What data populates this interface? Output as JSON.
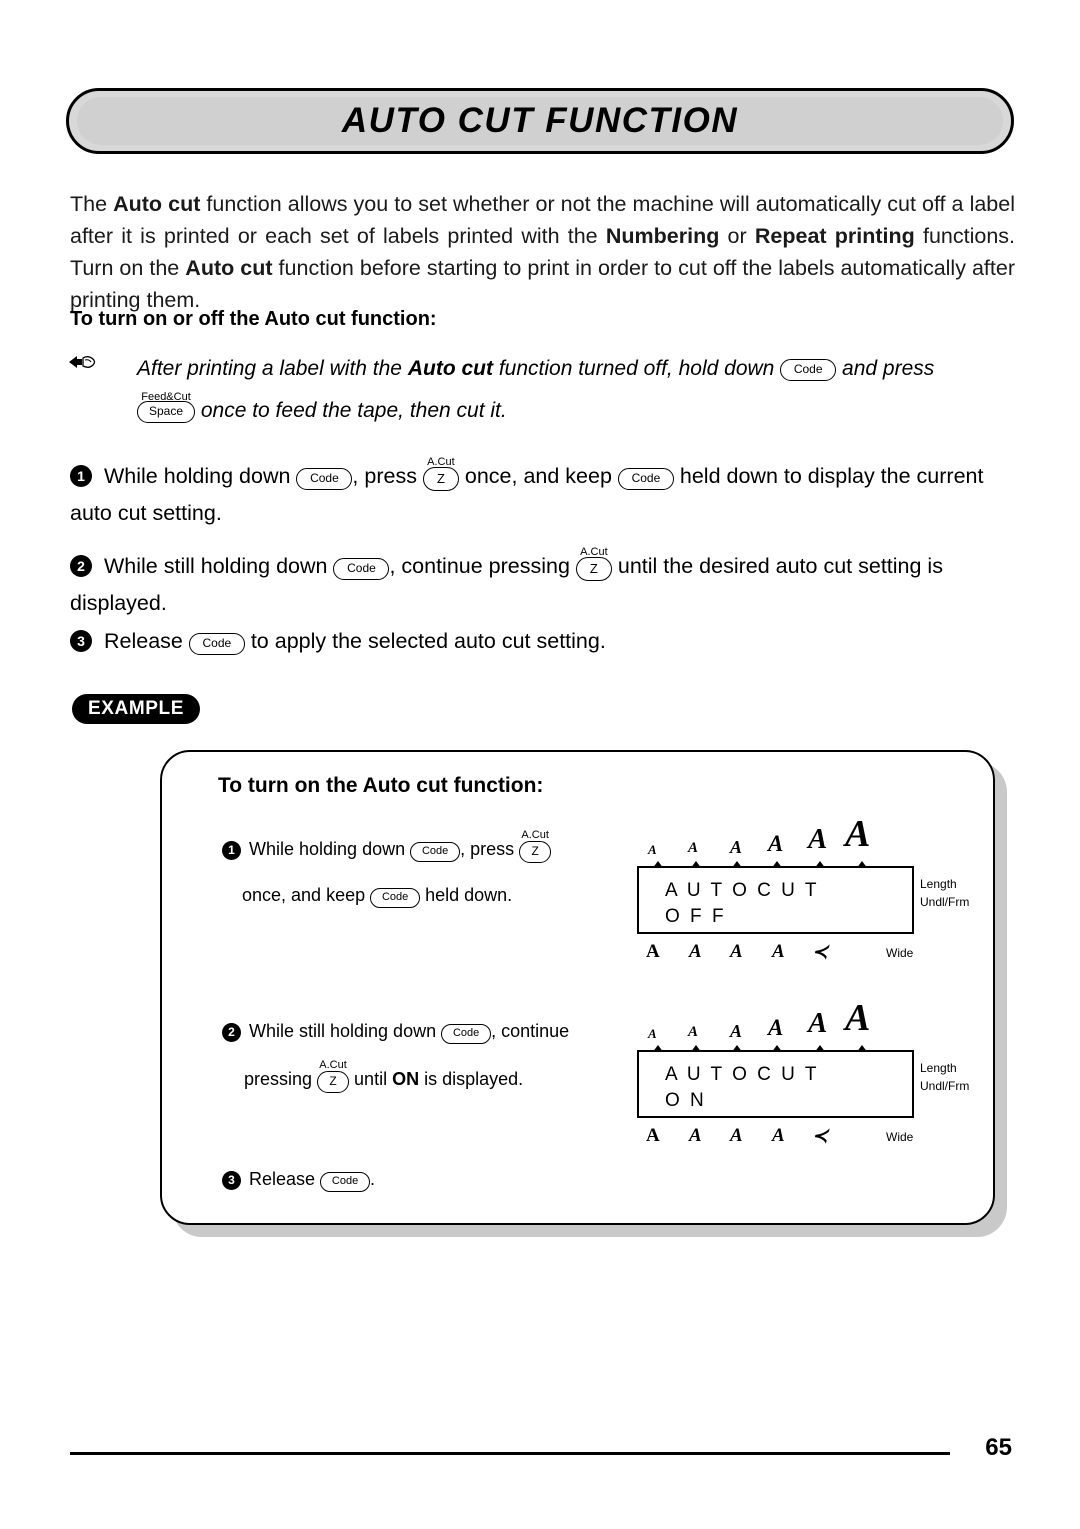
{
  "title": "AUTO CUT FUNCTION",
  "intro": {
    "p1_a": "The ",
    "p1_b": "Auto cut",
    "p1_c": " function allows you to set whether or not the machine will automatically cut off a label after it is printed or each set of labels printed with the ",
    "p1_d": "Numbering",
    "p1_e": " or ",
    "p1_f": "Repeat printing",
    "p1_g": " functions. Turn on the ",
    "p1_h": "Auto cut",
    "p1_i": " function before starting to print in order to cut off the labels automatically after printing them."
  },
  "subhead": "To turn on or off the Auto cut function:",
  "note": {
    "icon": "pointing-hand-icon",
    "t1": "After printing a label with the ",
    "t2": "Auto cut",
    "t3": " function turned off, hold down ",
    "key_code": "Code",
    "t4": " and press",
    "key_space_label": "Feed&Cut",
    "key_space": "Space",
    "t5": " once to feed the tape, then cut it."
  },
  "steps": [
    {
      "num": "1",
      "t1": "While holding down ",
      "key1": "Code",
      "t2": ", press ",
      "key2_label": "A.Cut",
      "key2": "Z",
      "t3": " once, and keep ",
      "key3": "Code",
      "t4": " held down to display the current auto cut setting."
    },
    {
      "num": "2",
      "t1": "While still holding down ",
      "key1": "Code",
      "t2": ", continue pressing ",
      "key2_label": "A.Cut",
      "key2": "Z",
      "t3": " until the desired auto cut setting is displayed."
    },
    {
      "num": "3",
      "t1": "Release ",
      "key1": "Code",
      "t2": " to apply the selected auto cut setting."
    }
  ],
  "example": {
    "badge": "EXAMPLE",
    "title": "To turn on the Auto cut function:",
    "steps": [
      {
        "num": "1",
        "t1": "While holding down ",
        "key1": "Code",
        "t2": ", press ",
        "key2_label": "A.Cut",
        "key2": "Z",
        "t3": "once, and keep ",
        "key3": "Code",
        "t4": " held down."
      },
      {
        "num": "2",
        "t1": "While still holding down ",
        "key1": "Code",
        "t2": ", continue",
        "t3": "pressing ",
        "key2_label": "A.Cut",
        "key2": "Z",
        "t4": " until ",
        "t5": "ON",
        "t6": " is displayed."
      },
      {
        "num": "3",
        "t1": "Release ",
        "key1": "Code",
        "t2": "."
      }
    ],
    "displays": [
      {
        "line1": "A U T O   C U T",
        "line2": "O F F",
        "side_top": "Length",
        "side_mid": "Undl/Frm",
        "side_bottom": "Wide",
        "top_marks": [
          "A",
          "A",
          "A",
          "A",
          "A",
          "A"
        ],
        "bottom_marks": [
          "A",
          "A",
          "A",
          "A",
          "≺"
        ]
      },
      {
        "line1": "A U T O   C U T",
        "line2": "O N",
        "side_top": "Length",
        "side_mid": "Undl/Frm",
        "side_bottom": "Wide",
        "top_marks": [
          "A",
          "A",
          "A",
          "A",
          "A",
          "A"
        ],
        "bottom_marks": [
          "A",
          "A",
          "A",
          "A",
          "≺"
        ]
      }
    ]
  },
  "footer": {
    "page_number": "65"
  }
}
